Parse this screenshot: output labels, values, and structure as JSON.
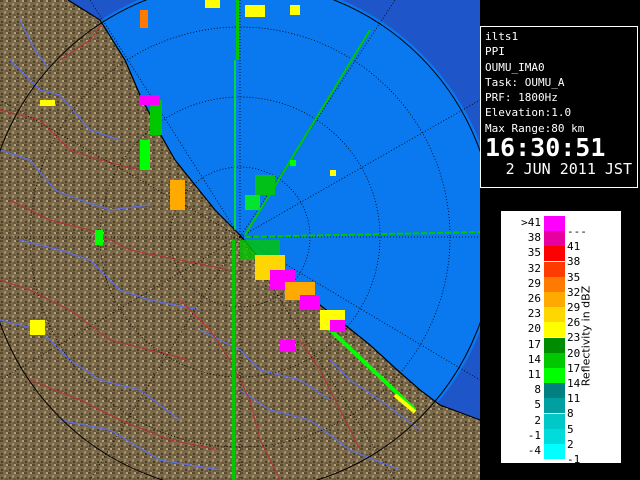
{
  "info": {
    "station": "ilts1",
    "scan_type": "PPI",
    "product": "OUMU_IMA0",
    "task": "Task: OUMU_A",
    "prf": "PRF: 1800Hz",
    "elevation": "Elevation:1.0",
    "max_range": "Max Range:80 km",
    "time": "16:30:51",
    "date": "2 JUN 2011 JST"
  },
  "legend": {
    "title": "Reflectivity in dBZ",
    "rows": [
      {
        "label": ">41",
        "upper": "---",
        "color": "#ff00ff"
      },
      {
        "label": "38",
        "upper": "41",
        "color": "#e600a0"
      },
      {
        "label": "35",
        "upper": "38",
        "color": "#ff0000"
      },
      {
        "label": "32",
        "upper": "35",
        "color": "#ff3c00"
      },
      {
        "label": "29",
        "upper": "32",
        "color": "#ff7a00"
      },
      {
        "label": "26",
        "upper": "29",
        "color": "#ffaa00"
      },
      {
        "label": "23",
        "upper": "26",
        "color": "#ffd700"
      },
      {
        "label": "20",
        "upper": "23",
        "color": "#ffff00"
      },
      {
        "label": "17",
        "upper": "20",
        "color": "#008c00"
      },
      {
        "label": "14",
        "upper": "17",
        "color": "#00c800"
      },
      {
        "label": "11",
        "upper": "14",
        "color": "#00ff00"
      },
      {
        "label": "8",
        "upper": "11",
        "color": "#008080"
      },
      {
        "label": "5",
        "upper": "8",
        "color": "#00a0a0"
      },
      {
        "label": "2",
        "upper": "5",
        "color": "#00c8c8"
      },
      {
        "label": "-1",
        "upper": "2",
        "color": "#00dcdc"
      },
      {
        "label": "-4",
        "upper": "-1",
        "color": "#00ffff"
      }
    ]
  },
  "colors": {
    "sea": "#0a78ee",
    "sea_out": "#1e55c8",
    "land": "#7a6a4a",
    "river": "#5a6ee6",
    "border": "#b43232"
  }
}
